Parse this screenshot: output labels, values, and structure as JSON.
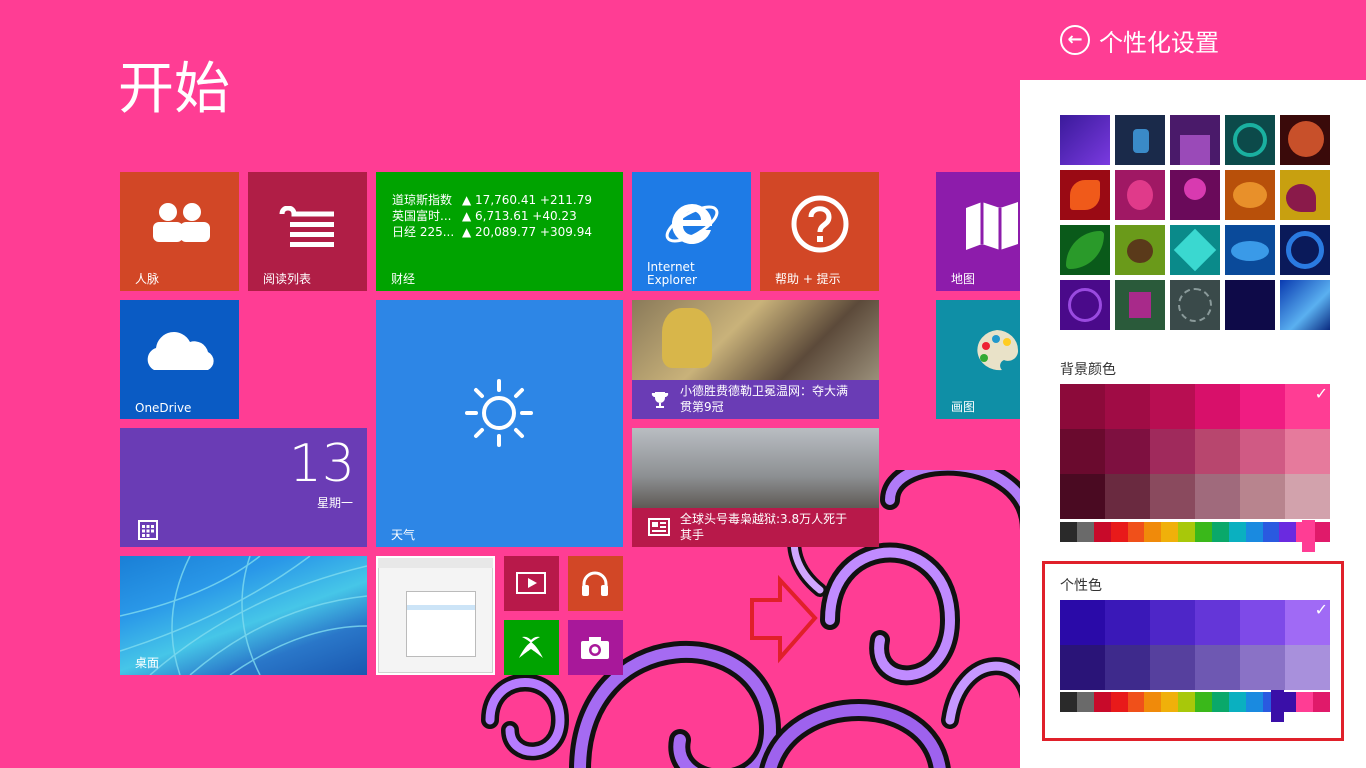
{
  "start": {
    "title": "开始",
    "tiles": {
      "people": "人脉",
      "reading": "阅读列表",
      "finance": "财经",
      "ie_line1": "Internet",
      "ie_line2": "Explorer",
      "help": "帮助 + 提示",
      "map": "地图",
      "onedrive": "OneDrive",
      "paint": "画图",
      "calendar_day": "13",
      "calendar_weekday": "星期一",
      "weather": "天气",
      "news1": "小德胜费德勒卫冕温网：夺大满贯第9冠",
      "news2": "全球头号毒枭越狱:3.8万人死于其手",
      "desktop": "桌面"
    },
    "finance_rows": [
      {
        "name": "道琼斯指数",
        "value": "▲ 17,760.41 +211.79"
      },
      {
        "name": "英国富时...",
        "value": "▲ 6,713.61 +40.23"
      },
      {
        "name": "日经 225...",
        "value": "▲ 20,089.77 +309.94"
      }
    ]
  },
  "panel": {
    "title": "个性化设置",
    "background_color_label": "背景颜色",
    "accent_color_label": "个性色",
    "check": "✓"
  },
  "colors": {
    "start_bg": "#ff3d94",
    "accent_selected": "#3a0fa8",
    "highlight_box": "#e0202a"
  },
  "icons": {
    "back": "back-arrow-icon",
    "people": "people-icon",
    "reading": "reading-list-icon",
    "ie": "internet-explorer-icon",
    "help": "question-icon",
    "map": "map-icon",
    "onedrive": "cloud-icon",
    "paint": "palette-icon",
    "weather": "sun-icon"
  }
}
